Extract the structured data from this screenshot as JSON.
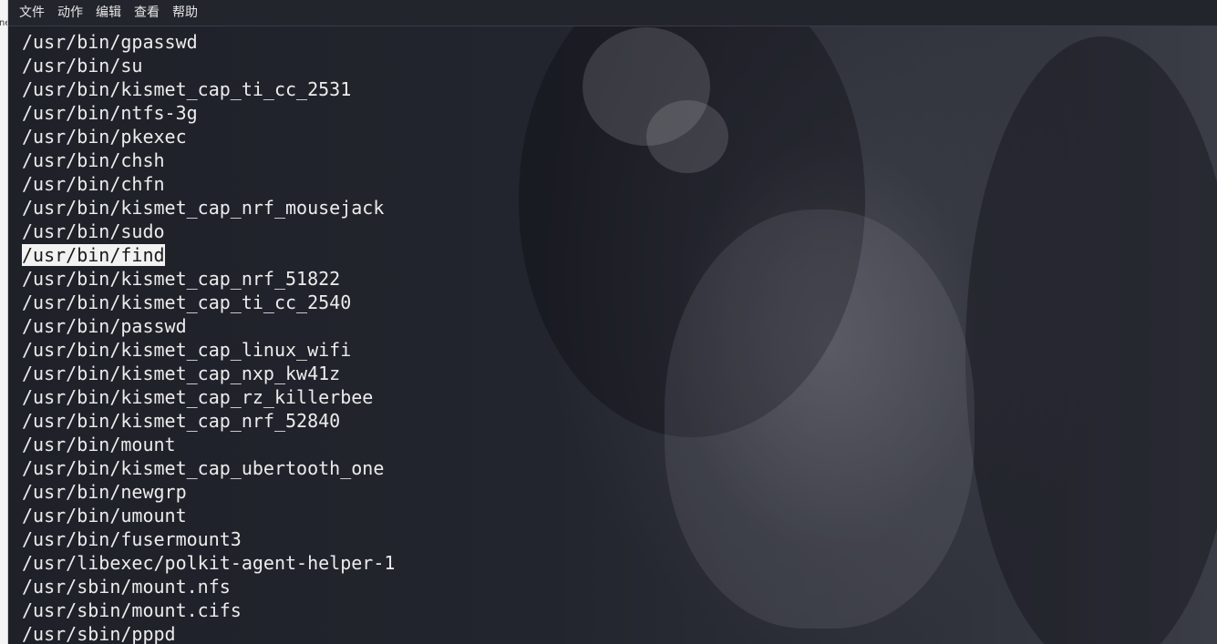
{
  "left_window": {
    "fragment": "ne"
  },
  "menu": {
    "items": [
      "文件",
      "动作",
      "编辑",
      "查看",
      "帮助"
    ]
  },
  "terminal": {
    "selected_line_index": 9,
    "lines": [
      "/usr/bin/gpasswd",
      "/usr/bin/su",
      "/usr/bin/kismet_cap_ti_cc_2531",
      "/usr/bin/ntfs-3g",
      "/usr/bin/pkexec",
      "/usr/bin/chsh",
      "/usr/bin/chfn",
      "/usr/bin/kismet_cap_nrf_mousejack",
      "/usr/bin/sudo",
      "/usr/bin/find",
      "/usr/bin/kismet_cap_nrf_51822",
      "/usr/bin/kismet_cap_ti_cc_2540",
      "/usr/bin/passwd",
      "/usr/bin/kismet_cap_linux_wifi",
      "/usr/bin/kismet_cap_nxp_kw41z",
      "/usr/bin/kismet_cap_rz_killerbee",
      "/usr/bin/kismet_cap_nrf_52840",
      "/usr/bin/mount",
      "/usr/bin/kismet_cap_ubertooth_one",
      "/usr/bin/newgrp",
      "/usr/bin/umount",
      "/usr/bin/fusermount3",
      "/usr/libexec/polkit-agent-helper-1",
      "/usr/sbin/mount.nfs",
      "/usr/sbin/mount.cifs",
      "/usr/sbin/pppd"
    ]
  },
  "colors": {
    "terminal_text": "#ececec",
    "selection_bg": "#f2f2f2",
    "menubar_bg": "#23252d"
  }
}
